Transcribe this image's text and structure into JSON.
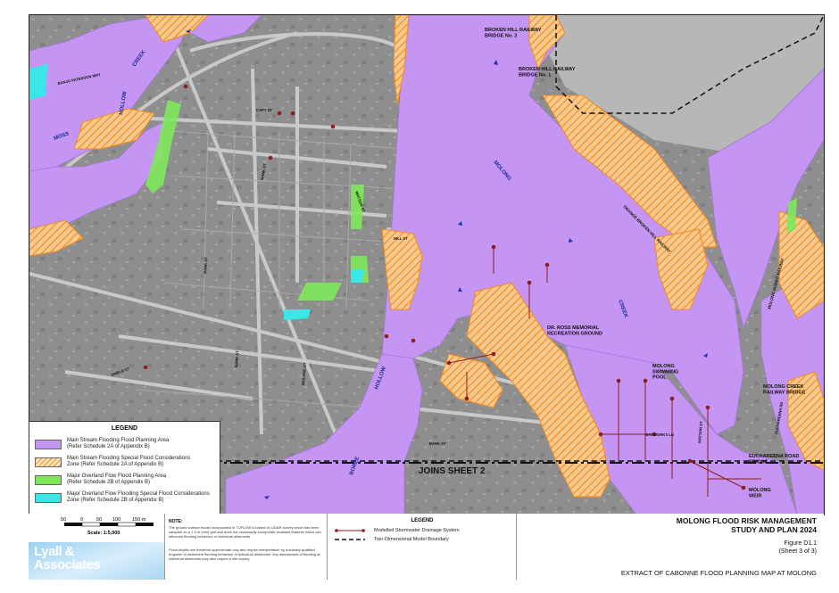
{
  "map": {
    "labels": {
      "rail_bridge_2": "BROKEN HILL RAILWAY\nBRIDGE No. 2",
      "rail_bridge_1": "BROKEN HILL RAILWAY\nBRIDGE No. 1",
      "creek_north": "CREEK",
      "hollow_north": "HOLLOW",
      "moss": "MOSS",
      "molong": "MOLONG",
      "creek_east": "CREEK",
      "railway_orange": "ORANGE BROKEN HILL RAILWAY",
      "railway_dubbo": "MOLONG DUBBO RAILWAY",
      "dr_ross": "DR. ROSS MEMORIAL\nRECREATION GROUND",
      "swimming_pool": "MOLONG\nSWIMMING\nPOOL",
      "creek_railway_bridge": "MOLONG CREEK\nRAILWAY BRIDGE",
      "euchareena_bridge": "EUCHAREENA ROAD\nBRIDGE",
      "molong_weir": "MOLONG\nWEIR",
      "joins_sheet": "JOINS SHEET 2",
      "hollow_south": "HOLLOW",
      "boree": "BOREE",
      "streets": [
        "BANJO PATERSON WAY",
        "CAPT ST",
        "BANK ST",
        "WATSON ST",
        "HILL ST",
        "BANK ST",
        "GASWORKS LN",
        "BANK ST",
        "MOLONG ST",
        "SHIELD ST",
        "BANK ST",
        "EUCHAREENA RD",
        "WATSON ST"
      ]
    }
  },
  "legend": {
    "title": "LEGEND",
    "items": [
      {
        "label": "Main Stream Flooding Flood Planning Area\n(Refer Schedule 2A of Appendix B)"
      },
      {
        "label": "Main Stream Flooding Special Flood Considerations\nZone (Refer Schedule 2A of Appendix B)"
      },
      {
        "label": "Major Overland Flow Flood Planning Area\n(Refer Schedule 2B of Appendix B)"
      },
      {
        "label": "Major Overland Flow Flooding Special Flood Considerations\nZone (Refer Schedule 2B of Appendix B)"
      }
    ]
  },
  "scale": {
    "ticks": [
      "50",
      "0",
      "50",
      "100",
      "150 m"
    ],
    "label": "Scale: 1:5,000"
  },
  "logo": "Lyall &\nAssociates",
  "notes": {
    "title": "NOTE:",
    "para1": "The ground surface model incorporated in TUFLOW is based on LiDAR survey which has been sampled on a 1.5 m (min) grid and does not necessarily incorporate localised features which can influence flooding behaviour in individual allotments.",
    "para2": "Flood depths are therefore approximate only and require interpretation by a suitably qualified engineer to determine flooding behaviour in individual allotments. Any assessment of flooding at individual allotments may also require a site survey."
  },
  "map_legend2": {
    "title": "LEGEND",
    "items": [
      {
        "label": "Modelled Stormwater Drainage System"
      },
      {
        "label": "Two-Dimensional Model Boundary"
      }
    ]
  },
  "title_block": {
    "title": "MOLONG FLOOD RISK MANAGEMENT\nSTUDY AND PLAN 2024",
    "figure": "Figure D1.1",
    "sheet": "(Sheet 3 of 3)",
    "extract": "EXTRACT OF CABONNE FLOOD PLANNING MAP AT MOLONG"
  },
  "colors": {
    "main_stream": "#c495f2",
    "special_zone": "#f3a54a",
    "overland": "#7fe85a",
    "overland_special": "#38e8e8",
    "drainage": "#8b1e1e"
  }
}
